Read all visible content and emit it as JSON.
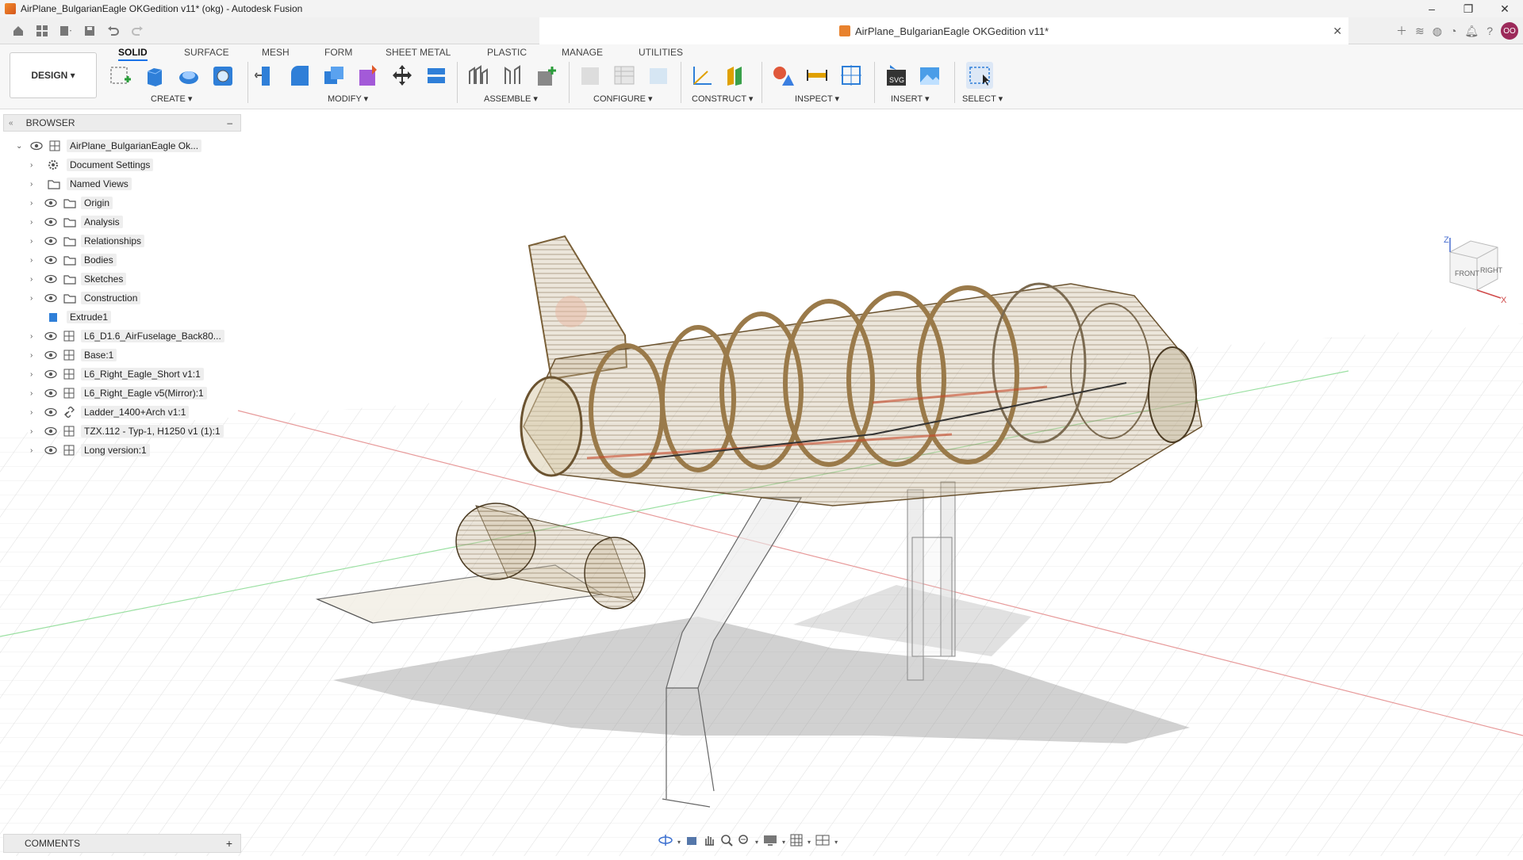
{
  "window": {
    "title": "AirPlane_BulgarianEagle OKGedition v11* (okg) - Autodesk Fusion",
    "controls": [
      "–",
      "❐",
      "✕"
    ]
  },
  "doc_tab": {
    "title": "AirPlane_BulgarianEagle OKGedition v11*",
    "close": "✕"
  },
  "user": {
    "initials": "OO"
  },
  "workspace": {
    "label": "DESIGN ▾"
  },
  "ribbon": {
    "tabs": [
      "SOLID",
      "SURFACE",
      "MESH",
      "FORM",
      "SHEET METAL",
      "PLASTIC",
      "MANAGE",
      "UTILITIES"
    ],
    "groups": [
      "CREATE ▾",
      "MODIFY ▾",
      "ASSEMBLE ▾",
      "CONFIGURE ▾",
      "CONSTRUCT ▾",
      "INSPECT ▾",
      "INSERT ▾",
      "SELECT ▾"
    ]
  },
  "browser": {
    "title": "BROWSER",
    "collapse": "–",
    "root": "AirPlane_BulgarianEagle Ok...",
    "items": [
      {
        "label": "Document Settings",
        "icon": "gear-icon"
      },
      {
        "label": "Named Views",
        "icon": "folder-icon"
      },
      {
        "label": "Origin",
        "icon": "folder-icon"
      },
      {
        "label": "Analysis",
        "icon": "folder-icon"
      },
      {
        "label": "Relationships",
        "icon": "folder-icon"
      },
      {
        "label": "Bodies",
        "icon": "folder-icon"
      },
      {
        "label": "Sketches",
        "icon": "folder-icon"
      },
      {
        "label": "Construction",
        "icon": "folder-icon"
      },
      {
        "label": "Extrude1",
        "icon": "extrude-icon"
      },
      {
        "label": "L6_D1.6_AirFuselage_Back80...",
        "icon": "component-icon"
      },
      {
        "label": "Base:1",
        "icon": "component-icon"
      },
      {
        "label": "L6_Right_Eagle_Short v1:1",
        "icon": "component-icon"
      },
      {
        "label": "L6_Right_Eagle v5(Mirror):1",
        "icon": "component-icon"
      },
      {
        "label": "Ladder_1400+Arch v1:1",
        "icon": "link-icon"
      },
      {
        "label": "TZX.112 - Typ-1, H1250 v1 (1):1",
        "icon": "component-icon"
      },
      {
        "label": "Long version:1",
        "icon": "component-icon"
      }
    ]
  },
  "comments": {
    "title": "COMMENTS",
    "add": "+"
  },
  "viewcube": {
    "front": "FRONT",
    "right": "RIGHT",
    "z": "Z",
    "x": "X"
  },
  "colors": {
    "accent": "#1a73e8",
    "wood": "#a58a5e",
    "panel": "#ececec"
  }
}
